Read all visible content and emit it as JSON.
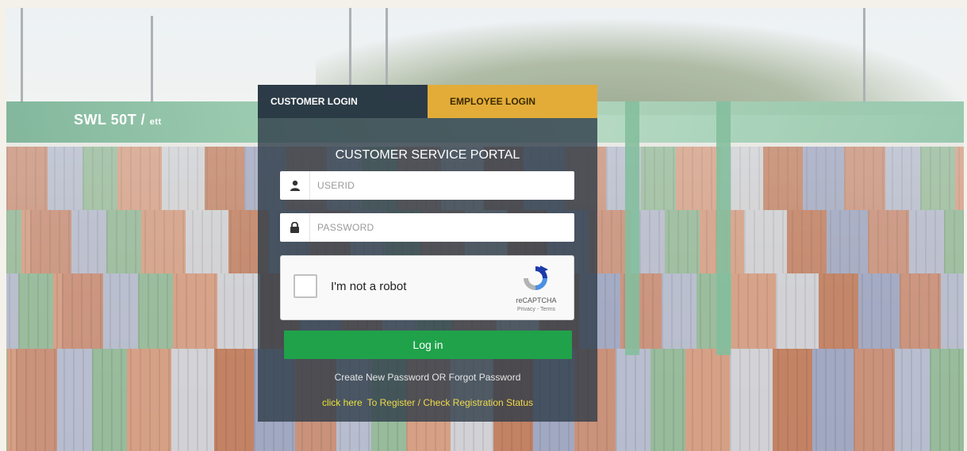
{
  "tabs": {
    "customer": "CUSTOMER LOGIN",
    "employee": "EMPLOYEE LOGIN"
  },
  "portal_title": "CUSTOMER SERVICE PORTAL",
  "userid": {
    "placeholder": "USERID",
    "value": "",
    "icon": "user-icon"
  },
  "password": {
    "placeholder": "PASSWORD",
    "value": "",
    "icon": "lock-icon"
  },
  "captcha": {
    "label": "I'm not a robot",
    "brand": "reCAPTCHA",
    "links": "Privacy - Terms",
    "checked": false
  },
  "login_button": "Log in",
  "forgot_link": "Create New Password OR Forgot Password",
  "register": {
    "click_here": "click here",
    "text": "To Register / Check Registration Status"
  },
  "background": {
    "gantry_text": "SWL 50T /",
    "gantry_unit": "ett"
  },
  "colors": {
    "card": "#2e3c48",
    "employee_tab": "#e3ac39",
    "login_button": "#1fa24a",
    "register_link": "#f2d94a"
  }
}
